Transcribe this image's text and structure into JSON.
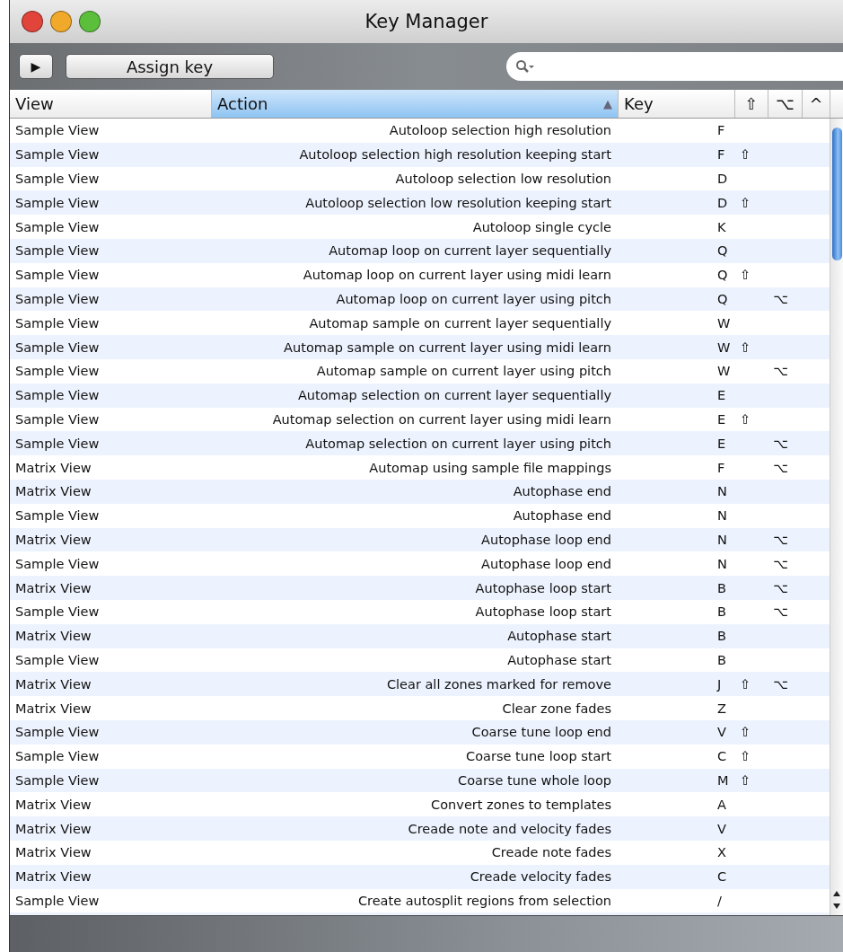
{
  "window": {
    "title": "Key Manager"
  },
  "toolbar": {
    "play_button": "▶",
    "assign_button": "Assign key"
  },
  "table": {
    "columns": [
      {
        "label": "View",
        "selected": false
      },
      {
        "label": "Action",
        "selected": true,
        "sort": "▲"
      },
      {
        "label": "Key",
        "selected": false
      },
      {
        "label": "⇧",
        "selected": false
      },
      {
        "label": "⌥",
        "selected": false
      },
      {
        "label": "^",
        "selected": false
      }
    ],
    "rows": [
      {
        "view": "Sample View",
        "action": "Autoloop selection high resolution",
        "key": "F"
      },
      {
        "view": "Sample View",
        "action": "Autoloop selection high resolution keeping start",
        "key": "F",
        "shift": "⇧"
      },
      {
        "view": "Sample View",
        "action": "Autoloop selection low resolution",
        "key": "D"
      },
      {
        "view": "Sample View",
        "action": "Autoloop selection low resolution keeping start",
        "key": "D",
        "shift": "⇧"
      },
      {
        "view": "Sample View",
        "action": "Autoloop single cycle",
        "key": "K"
      },
      {
        "view": "Sample View",
        "action": "Automap loop on current layer sequentially",
        "key": "Q"
      },
      {
        "view": "Sample View",
        "action": "Automap loop on current layer using midi learn",
        "key": "Q",
        "shift": "⇧"
      },
      {
        "view": "Sample View",
        "action": "Automap loop on current layer using pitch",
        "key": "Q",
        "option": "⌥"
      },
      {
        "view": "Sample View",
        "action": "Automap sample on current layer sequentially",
        "key": "W"
      },
      {
        "view": "Sample View",
        "action": "Automap sample on current layer using midi learn",
        "key": "W",
        "shift": "⇧"
      },
      {
        "view": "Sample View",
        "action": "Automap sample on current layer using pitch",
        "key": "W",
        "option": "⌥"
      },
      {
        "view": "Sample View",
        "action": "Automap selection on current layer sequentially",
        "key": "E"
      },
      {
        "view": "Sample View",
        "action": "Automap selection on current layer using midi learn",
        "key": "E",
        "shift": "⇧"
      },
      {
        "view": "Sample View",
        "action": "Automap selection on current layer using pitch",
        "key": "E",
        "option": "⌥"
      },
      {
        "view": "Matrix View",
        "action": "Automap using sample file mappings",
        "key": "F",
        "option": "⌥"
      },
      {
        "view": "Matrix View",
        "action": "Autophase end",
        "key": "N"
      },
      {
        "view": "Sample View",
        "action": "Autophase end",
        "key": "N"
      },
      {
        "view": "Matrix View",
        "action": "Autophase loop end",
        "key": "N",
        "option": "⌥"
      },
      {
        "view": "Sample View",
        "action": "Autophase loop end",
        "key": "N",
        "option": "⌥"
      },
      {
        "view": "Matrix View",
        "action": "Autophase loop start",
        "key": "B",
        "option": "⌥"
      },
      {
        "view": "Sample View",
        "action": "Autophase loop start",
        "key": "B",
        "option": "⌥"
      },
      {
        "view": "Matrix View",
        "action": "Autophase start",
        "key": "B"
      },
      {
        "view": "Sample View",
        "action": "Autophase start",
        "key": "B"
      },
      {
        "view": "Matrix View",
        "action": "Clear all zones marked for remove",
        "key": "J",
        "shift": "⇧",
        "option": "⌥"
      },
      {
        "view": "Matrix View",
        "action": "Clear zone fades",
        "key": "Z"
      },
      {
        "view": "Sample View",
        "action": "Coarse tune loop end",
        "key": "V",
        "shift": "⇧"
      },
      {
        "view": "Sample View",
        "action": "Coarse tune loop start",
        "key": "C",
        "shift": "⇧"
      },
      {
        "view": "Sample View",
        "action": "Coarse tune whole loop",
        "key": "M",
        "shift": "⇧"
      },
      {
        "view": "Matrix View",
        "action": "Convert zones to templates",
        "key": "A"
      },
      {
        "view": "Matrix View",
        "action": "Creade note and velocity fades",
        "key": "V"
      },
      {
        "view": "Matrix View",
        "action": "Creade note fades",
        "key": "X"
      },
      {
        "view": "Matrix View",
        "action": "Creade velocity fades",
        "key": "C"
      },
      {
        "view": "Sample View",
        "action": "Create autosplit regions from selection",
        "key": "/"
      }
    ]
  }
}
